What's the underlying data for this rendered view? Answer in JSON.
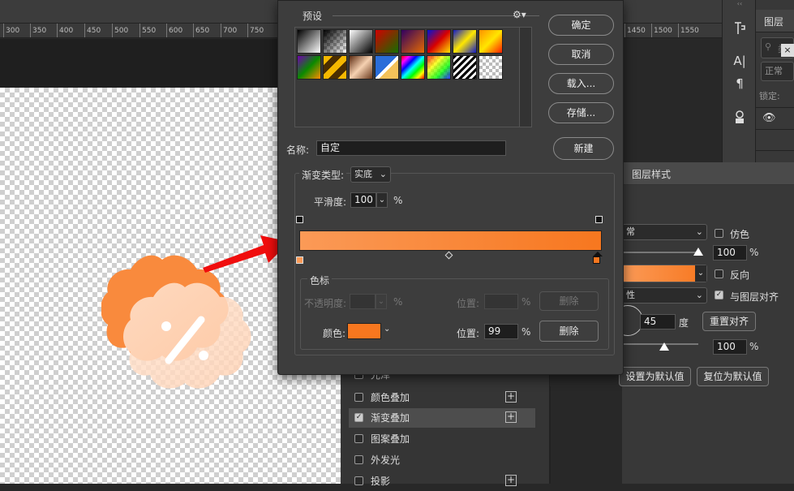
{
  "ruler": {
    "ticks": [
      "300",
      "350",
      "400",
      "450",
      "500",
      "550",
      "600",
      "650",
      "700",
      "750",
      "1450",
      "1500",
      "1550"
    ]
  },
  "tools": {
    "icons": [
      "pen-icon",
      "text-icon",
      "paragraph-icon",
      "stamp-icon"
    ],
    "symbols": [
      "A|",
      "¶"
    ]
  },
  "layers_panel": {
    "tab": "图层",
    "search_placeholder": "类",
    "blend": "正常",
    "lock_label": "锁定:"
  },
  "dialog": {
    "presets_label": "预设",
    "buttons": {
      "ok": "确定",
      "cancel": "取消",
      "load": "载入...",
      "save": "存储...",
      "new": "新建"
    },
    "name_label": "名称:",
    "name_value": "自定",
    "gradient_type_label": "渐变类型:",
    "gradient_type_value": "实底",
    "smoothness_label": "平滑度:",
    "smoothness_value": "100",
    "percent": "%",
    "stops_group": "色标",
    "opacity_label": "不透明度:",
    "location_label": "位置:",
    "delete_label": "删除",
    "color_label": "颜色:",
    "color_value": "#f7771f",
    "color_location_value": "99",
    "gradient_start": "#fb9a57",
    "gradient_end": "#f7771f"
  },
  "layer_style": {
    "title": "图层样式",
    "blend_value": "常",
    "dither_label": "仿色",
    "opacity_value": "100",
    "reverse_label": "反向",
    "style_value": "性",
    "align_label": "与图层对齐",
    "angle_value": "45",
    "degree_label": "度",
    "reset_align": "重置对齐",
    "scale_value": "100",
    "percent": "%",
    "set_default": "设置为默认值",
    "reset_default": "复位为默认值",
    "effects": [
      {
        "label": "光泽",
        "checked": false,
        "plus": false
      },
      {
        "label": "颜色叠加",
        "checked": false,
        "plus": true
      },
      {
        "label": "渐变叠加",
        "checked": true,
        "plus": true
      },
      {
        "label": "图案叠加",
        "checked": false,
        "plus": false
      },
      {
        "label": "外发光",
        "checked": false,
        "plus": false
      },
      {
        "label": "投影",
        "checked": false,
        "plus": true
      }
    ]
  }
}
